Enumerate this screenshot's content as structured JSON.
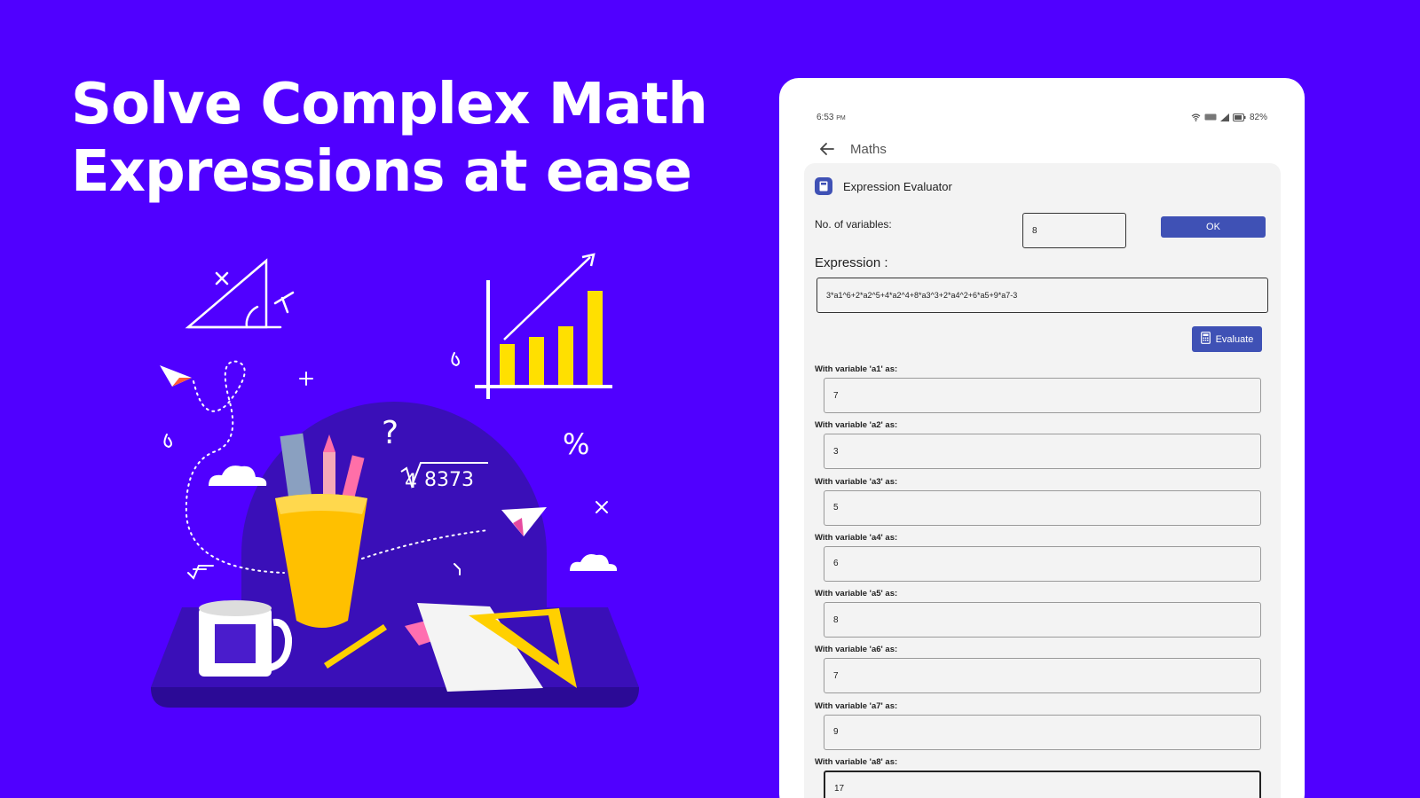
{
  "headline": {
    "line1": "Solve Complex Math",
    "line2": "Expressions at ease"
  },
  "illustration": {
    "root_text": "8373",
    "root_index": "4",
    "question_mark": "?",
    "percent": "%"
  },
  "status_bar": {
    "time": "6:53",
    "ampm": "PM",
    "battery": "82%",
    "icons": [
      "wifi-icon",
      "signal-icon",
      "battery-icon"
    ]
  },
  "app_bar": {
    "title": "Maths",
    "back_icon": "arrow-left-icon"
  },
  "card": {
    "title": "Expression Evaluator",
    "icon": "calculator-icon",
    "variables_label": "No. of variables:",
    "variables_value": "8",
    "ok_label": "OK",
    "expression_label": "Expression :",
    "expression_value": "3*a1^6+2*a2^5+4*a2^4+8*a3^3+2*a4^2+6*a5+9*a7-3",
    "evaluate_label": "Evaluate"
  },
  "variables": [
    {
      "label": "With variable 'a1' as:",
      "value": "7"
    },
    {
      "label": "With variable 'a2' as:",
      "value": "3"
    },
    {
      "label": "With variable 'a3' as:",
      "value": "5"
    },
    {
      "label": "With variable 'a4' as:",
      "value": "6"
    },
    {
      "label": "With variable 'a5' as:",
      "value": "8"
    },
    {
      "label": "With variable 'a6' as:",
      "value": "7"
    },
    {
      "label": "With variable 'a7' as:",
      "value": "9"
    },
    {
      "label": "With variable 'a8' as:",
      "value": "17"
    }
  ],
  "colors": {
    "background": "#5000ff",
    "accent": "#3f51b5",
    "yellow": "#ffe000",
    "dark_purple": "#3a0fb8"
  }
}
